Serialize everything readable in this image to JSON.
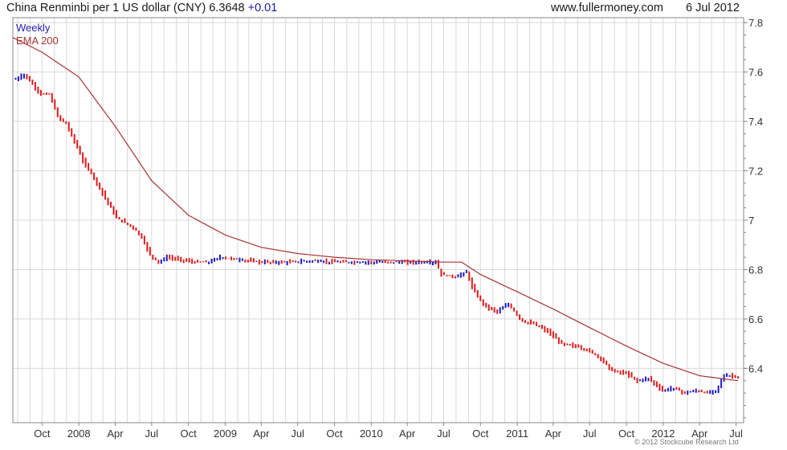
{
  "header": {
    "title": "China Renminbi per 1 US dollar (CNY) 6.3648",
    "change": "+0.01",
    "site": "www.fullermoney.com",
    "date": "6 Jul 2012"
  },
  "legend": {
    "weekly": "Weekly",
    "ema": "EMA 200"
  },
  "copyright": "© 2012 Stockcube Research Ltd",
  "colors": {
    "up": "#1a1acc",
    "down": "#e01b1b",
    "ema": "#a83232",
    "grid": "#d9d9d9",
    "axis": "#888888"
  },
  "chart_data": {
    "type": "line",
    "y_axis_side": "right",
    "ylim": [
      6.18,
      7.82
    ],
    "y_ticks": [
      6.4,
      6.6,
      6.8,
      7,
      7.2,
      7.4,
      7.6,
      7.8
    ],
    "y_tick_labels": [
      "6.4",
      "6.6",
      "6.8",
      "7",
      "7.2",
      "7.4",
      "7.6",
      "7.8"
    ],
    "x_range": [
      "2007-07-20",
      "2012-07-20"
    ],
    "x_ticks": [
      {
        "label": "Oct",
        "date": "2007-10-01"
      },
      {
        "label": "2008",
        "date": "2008-01-01"
      },
      {
        "label": "Apr",
        "date": "2008-04-01"
      },
      {
        "label": "Jul",
        "date": "2008-07-01"
      },
      {
        "label": "Oct",
        "date": "2008-10-01"
      },
      {
        "label": "2009",
        "date": "2009-01-01"
      },
      {
        "label": "Apr",
        "date": "2009-04-01"
      },
      {
        "label": "Jul",
        "date": "2009-07-01"
      },
      {
        "label": "Oct",
        "date": "2009-10-01"
      },
      {
        "label": "2010",
        "date": "2010-01-01"
      },
      {
        "label": "Apr",
        "date": "2010-04-01"
      },
      {
        "label": "Jul",
        "date": "2010-07-01"
      },
      {
        "label": "Oct",
        "date": "2010-10-01"
      },
      {
        "label": "2011",
        "date": "2011-01-01"
      },
      {
        "label": "Apr",
        "date": "2011-04-01"
      },
      {
        "label": "Jul",
        "date": "2011-07-01"
      },
      {
        "label": "Oct",
        "date": "2011-10-01"
      },
      {
        "label": "2012",
        "date": "2012-01-01"
      },
      {
        "label": "Apr",
        "date": "2012-04-01"
      },
      {
        "label": "Jul",
        "date": "2012-07-01"
      }
    ],
    "grid": true,
    "legend_position": "top-left",
    "series": [
      {
        "name": "Weekly",
        "style": "bars",
        "points": [
          {
            "x": "2007-07-27",
            "y": 7.57
          },
          {
            "x": "2007-08-17",
            "y": 7.59
          },
          {
            "x": "2007-09-07",
            "y": 7.55
          },
          {
            "x": "2007-09-28",
            "y": 7.51
          },
          {
            "x": "2007-10-19",
            "y": 7.51
          },
          {
            "x": "2007-11-09",
            "y": 7.42
          },
          {
            "x": "2007-11-30",
            "y": 7.39
          },
          {
            "x": "2007-12-21",
            "y": 7.32
          },
          {
            "x": "2008-01-11",
            "y": 7.24
          },
          {
            "x": "2008-02-01",
            "y": 7.19
          },
          {
            "x": "2008-02-22",
            "y": 7.13
          },
          {
            "x": "2008-03-14",
            "y": 7.07
          },
          {
            "x": "2008-04-04",
            "y": 7.01
          },
          {
            "x": "2008-04-25",
            "y": 6.99
          },
          {
            "x": "2008-05-16",
            "y": 6.97
          },
          {
            "x": "2008-06-06",
            "y": 6.93
          },
          {
            "x": "2008-06-27",
            "y": 6.86
          },
          {
            "x": "2008-07-18",
            "y": 6.83
          },
          {
            "x": "2008-08-08",
            "y": 6.85
          },
          {
            "x": "2008-09-12",
            "y": 6.84
          },
          {
            "x": "2008-10-17",
            "y": 6.83
          },
          {
            "x": "2008-11-21",
            "y": 6.83
          },
          {
            "x": "2008-12-19",
            "y": 6.85
          },
          {
            "x": "2009-02-06",
            "y": 6.84
          },
          {
            "x": "2009-04-03",
            "y": 6.83
          },
          {
            "x": "2009-06-05",
            "y": 6.83
          },
          {
            "x": "2009-08-07",
            "y": 6.835
          },
          {
            "x": "2009-10-09",
            "y": 6.83
          },
          {
            "x": "2009-12-11",
            "y": 6.83
          },
          {
            "x": "2010-02-05",
            "y": 6.83
          },
          {
            "x": "2010-04-02",
            "y": 6.83
          },
          {
            "x": "2010-06-11",
            "y": 6.83
          },
          {
            "x": "2010-06-25",
            "y": 6.78
          },
          {
            "x": "2010-07-30",
            "y": 6.77
          },
          {
            "x": "2010-08-27",
            "y": 6.79
          },
          {
            "x": "2010-09-10",
            "y": 6.73
          },
          {
            "x": "2010-09-24",
            "y": 6.69
          },
          {
            "x": "2010-10-15",
            "y": 6.65
          },
          {
            "x": "2010-11-12",
            "y": 6.63
          },
          {
            "x": "2010-12-10",
            "y": 6.66
          },
          {
            "x": "2011-01-14",
            "y": 6.59
          },
          {
            "x": "2011-02-11",
            "y": 6.58
          },
          {
            "x": "2011-03-18",
            "y": 6.55
          },
          {
            "x": "2011-04-22",
            "y": 6.5
          },
          {
            "x": "2011-05-27",
            "y": 6.49
          },
          {
            "x": "2011-07-01",
            "y": 6.47
          },
          {
            "x": "2011-07-29",
            "y": 6.44
          },
          {
            "x": "2011-08-26",
            "y": 6.39
          },
          {
            "x": "2011-09-30",
            "y": 6.38
          },
          {
            "x": "2011-10-28",
            "y": 6.35
          },
          {
            "x": "2011-11-25",
            "y": 6.36
          },
          {
            "x": "2011-12-30",
            "y": 6.31
          },
          {
            "x": "2012-01-27",
            "y": 6.32
          },
          {
            "x": "2012-02-24",
            "y": 6.3
          },
          {
            "x": "2012-03-23",
            "y": 6.31
          },
          {
            "x": "2012-04-20",
            "y": 6.3
          },
          {
            "x": "2012-05-11",
            "y": 6.31
          },
          {
            "x": "2012-06-01",
            "y": 6.37
          },
          {
            "x": "2012-06-22",
            "y": 6.37
          },
          {
            "x": "2012-07-06",
            "y": 6.3648
          }
        ]
      },
      {
        "name": "EMA 200",
        "style": "line",
        "points": [
          {
            "x": "2007-07-20",
            "y": 7.74
          },
          {
            "x": "2007-10-01",
            "y": 7.68
          },
          {
            "x": "2008-01-01",
            "y": 7.58
          },
          {
            "x": "2008-04-01",
            "y": 7.38
          },
          {
            "x": "2008-07-01",
            "y": 7.16
          },
          {
            "x": "2008-10-01",
            "y": 7.02
          },
          {
            "x": "2009-01-01",
            "y": 6.94
          },
          {
            "x": "2009-04-01",
            "y": 6.89
          },
          {
            "x": "2009-07-01",
            "y": 6.865
          },
          {
            "x": "2009-10-01",
            "y": 6.85
          },
          {
            "x": "2010-01-01",
            "y": 6.84
          },
          {
            "x": "2010-04-01",
            "y": 6.835
          },
          {
            "x": "2010-07-01",
            "y": 6.83
          },
          {
            "x": "2010-08-15",
            "y": 6.83
          },
          {
            "x": "2010-10-01",
            "y": 6.78
          },
          {
            "x": "2011-01-01",
            "y": 6.71
          },
          {
            "x": "2011-04-01",
            "y": 6.64
          },
          {
            "x": "2011-07-01",
            "y": 6.565
          },
          {
            "x": "2011-10-01",
            "y": 6.49
          },
          {
            "x": "2012-01-01",
            "y": 6.42
          },
          {
            "x": "2012-04-01",
            "y": 6.37
          },
          {
            "x": "2012-07-06",
            "y": 6.35
          }
        ]
      }
    ]
  }
}
